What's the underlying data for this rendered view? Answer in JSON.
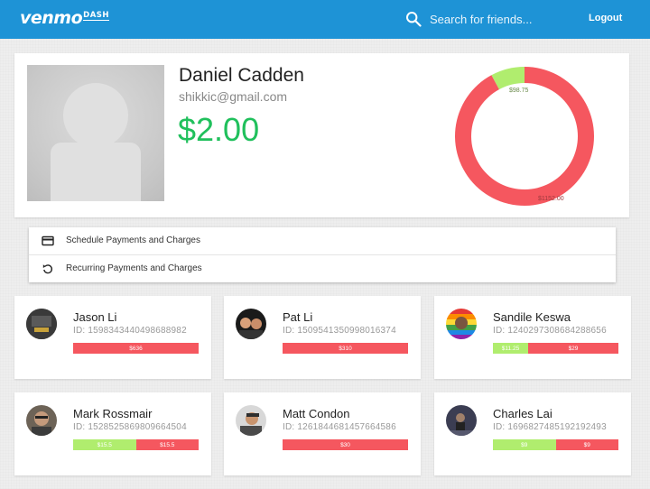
{
  "header": {
    "logo_main": "venmo",
    "logo_sub": "DASH",
    "search_placeholder": "Search for friends...",
    "logout_label": "Logout"
  },
  "profile": {
    "name": "Daniel Cadden",
    "email": "shikkic@gmail.com",
    "balance": "$2.00",
    "chart": {
      "green_label": "$98.75",
      "red_label": "$1152.00",
      "green_value": 98.75,
      "red_value": 1152.0
    }
  },
  "actions": [
    {
      "label": "Schedule Payments and Charges",
      "icon": "credit-card-icon"
    },
    {
      "label": "Recurring Payments and Charges",
      "icon": "refresh-icon"
    }
  ],
  "friends": [
    {
      "name": "Jason Li",
      "id": "ID: 1598343440498688982",
      "green": null,
      "red": "$636",
      "green_frac": 0
    },
    {
      "name": "Pat Li",
      "id": "ID: 1509541350998016374",
      "green": null,
      "red": "$310",
      "green_frac": 0
    },
    {
      "name": "Sandile Keswa",
      "id": "ID: 1240297308684288656",
      "green": "$11.25",
      "red": "$29",
      "green_frac": 0.28
    },
    {
      "name": "Mark Rossmair",
      "id": "ID: 1528525869809664504",
      "green": "$15.5",
      "red": "$15.5",
      "green_frac": 0.5
    },
    {
      "name": "Matt Condon",
      "id": "ID: 1261844681457664586",
      "green": null,
      "red": "$30",
      "green_frac": 0
    },
    {
      "name": "Charles Lai",
      "id": "ID: 1696827485192192493",
      "green": "$9",
      "red": "$9",
      "green_frac": 0.5
    }
  ],
  "colors": {
    "header": "#1e93d6",
    "balance": "#20c05c",
    "positive": "#b0ed6e",
    "negative": "#f5575f"
  }
}
